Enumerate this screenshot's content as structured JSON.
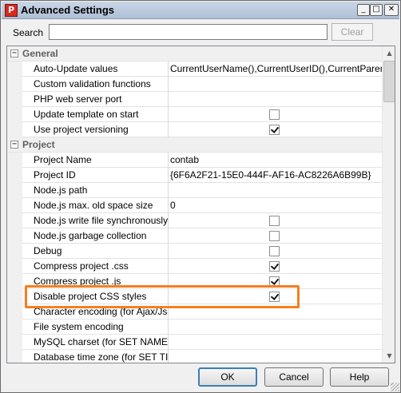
{
  "window": {
    "title": "Advanced Settings",
    "app_icon_letter": "P",
    "minimize_glyph": "_",
    "maximize_glyph": "□",
    "close_glyph": "✕"
  },
  "search": {
    "label": "Search",
    "value": "",
    "placeholder": "",
    "clear_label": "Clear"
  },
  "toggle_glyph": "−",
  "grid": {
    "general": {
      "title": "General",
      "auto_update": {
        "name": "Auto-Update values",
        "value": "CurrentUserName(),CurrentUserID(),CurrentParentUse"
      },
      "custom_validation": {
        "name": "Custom validation functions",
        "value": ""
      },
      "php_port": {
        "name": "PHP web server port",
        "value": ""
      },
      "update_template": {
        "name": "Update template on start",
        "checked": false
      },
      "versioning": {
        "name": "Use project versioning",
        "checked": true
      }
    },
    "project": {
      "title": "Project",
      "project_name": {
        "name": "Project Name",
        "value": "contab"
      },
      "project_id": {
        "name": "Project ID",
        "value": "{6F6A2F21-15E0-444F-AF16-AC8226A6B99B}"
      },
      "nodejs_path": {
        "name": "Node.js path",
        "value": ""
      },
      "nodejs_space": {
        "name": "Node.js max. old space size",
        "value": "0"
      },
      "nodejs_write": {
        "name": "Node.js write file synchronously",
        "checked": false
      },
      "nodejs_gc": {
        "name": "Node.js garbage collection",
        "checked": false
      },
      "debug": {
        "name": "Debug",
        "checked": false
      },
      "compress_css": {
        "name": "Compress project .css",
        "checked": true
      },
      "compress_js": {
        "name": "Compress project .js",
        "checked": true
      },
      "disable_css": {
        "name": "Disable project CSS styles",
        "checked": true
      },
      "char_encoding": {
        "name": "Character encoding (for Ajax/Json",
        "value": ""
      },
      "fs_encoding": {
        "name": "File system encoding",
        "value": ""
      },
      "mysql_charset": {
        "name": "MySQL charset (for SET NAMES)",
        "value": ""
      },
      "db_timezone": {
        "name": "Database time zone (for SET TIME",
        "value": ""
      }
    }
  },
  "scrollbar": {
    "up_glyph": "▲",
    "down_glyph": "▼"
  },
  "buttons": {
    "ok": "OK",
    "cancel": "Cancel",
    "help": "Help"
  },
  "colors": {
    "highlight": "#f57f20",
    "titlebar": "#c9d6e6",
    "app_icon": "#d62b1e"
  }
}
